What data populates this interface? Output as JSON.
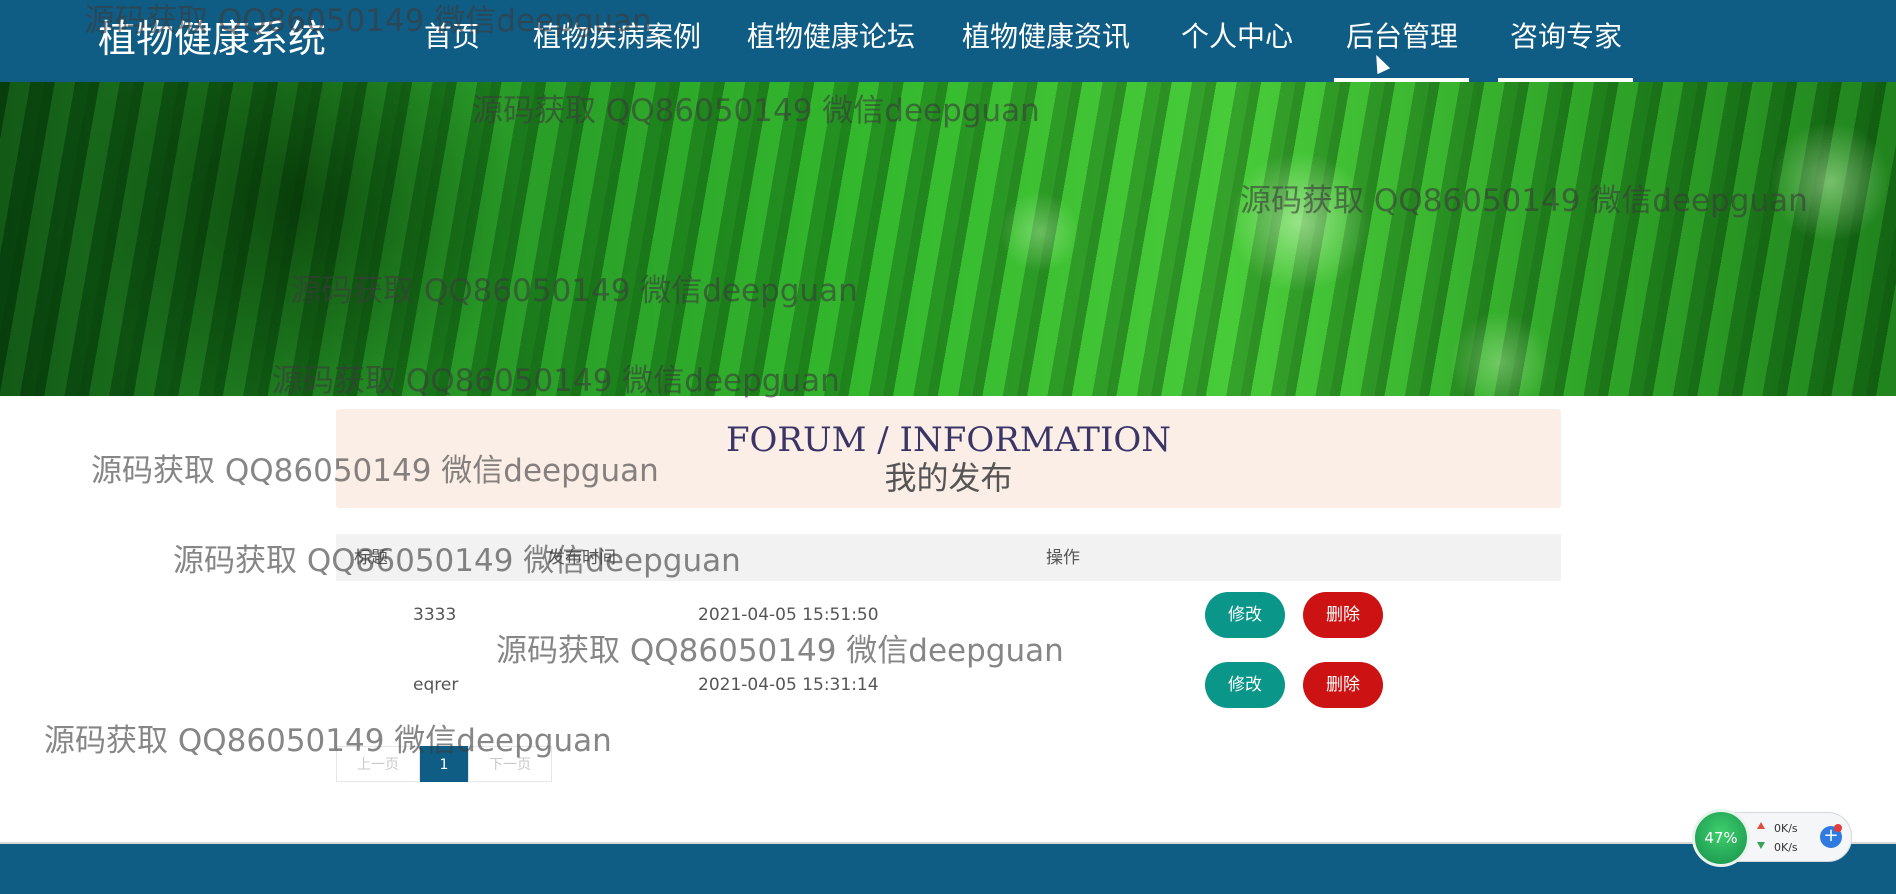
{
  "brand": "植物健康系统",
  "nav": [
    "首页",
    "植物疾病案例",
    "植物健康论坛",
    "植物健康资讯",
    "个人中心",
    "后台管理",
    "咨询专家"
  ],
  "hero": {
    "en": "FORUM / INFORMATION",
    "zh": "我的发布"
  },
  "table": {
    "headers": [
      "标题",
      "发布时间",
      "操作"
    ],
    "rows": [
      {
        "title": "3333",
        "time": "2021-04-05 15:51:50"
      },
      {
        "title": "eqrer",
        "time": "2021-04-05 15:31:14"
      }
    ],
    "edit_label": "修改",
    "delete_label": "删除"
  },
  "pager": {
    "prev": "上一页",
    "page": "1",
    "next": "下一页"
  },
  "watermark": "源码获取 QQ86050149 微信deepguan",
  "speed_widget": {
    "percent": "47%",
    "up": "0K/s",
    "down": "0K/s"
  },
  "colors": {
    "primary": "#0f5c85",
    "edit": "#0a9688",
    "delete": "#cc1212",
    "hero_bg": "#fbeee6"
  }
}
